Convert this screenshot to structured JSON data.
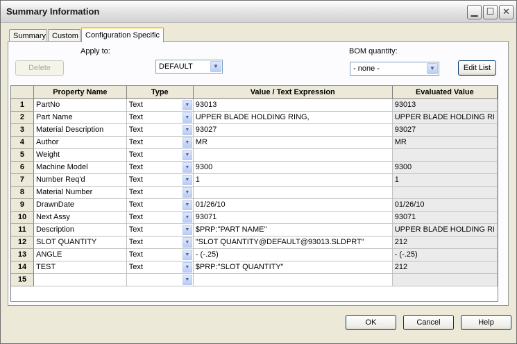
{
  "window": {
    "title": "Summary Information"
  },
  "tabs": [
    "Summary",
    "Custom",
    "Configuration Specific"
  ],
  "apply_to": {
    "label": "Apply to:",
    "value": "DEFAULT"
  },
  "delete_label": "Delete",
  "bom": {
    "label": "BOM quantity:",
    "value": "- none -"
  },
  "edit_list_label": "Edit List",
  "table": {
    "headers": [
      "Property Name",
      "Type",
      "Value / Text Expression",
      "Evaluated Value"
    ],
    "rows": [
      {
        "num": "1",
        "name": "PartNo",
        "type": "Text",
        "value": "93013",
        "eval": "93013"
      },
      {
        "num": "2",
        "name": "Part Name",
        "type": "Text",
        "value": "UPPER BLADE HOLDING RING,",
        "eval": "UPPER BLADE HOLDING RI"
      },
      {
        "num": "3",
        "name": "Material Description",
        "type": "Text",
        "value": "93027",
        "eval": "93027"
      },
      {
        "num": "4",
        "name": "Author",
        "type": "Text",
        "value": "MR",
        "eval": "MR"
      },
      {
        "num": "5",
        "name": "Weight",
        "type": "Text",
        "value": "",
        "eval": ""
      },
      {
        "num": "6",
        "name": "Machine Model",
        "type": "Text",
        "value": "9300",
        "eval": "9300"
      },
      {
        "num": "7",
        "name": "Number Req'd",
        "type": "Text",
        "value": "1",
        "eval": "1"
      },
      {
        "num": "8",
        "name": "Material Number",
        "type": "Text",
        "value": "",
        "eval": ""
      },
      {
        "num": "9",
        "name": "DrawnDate",
        "type": "Text",
        "value": "01/26/10",
        "eval": "01/26/10"
      },
      {
        "num": "10",
        "name": "Next Assy",
        "type": "Text",
        "value": "93071",
        "eval": "93071"
      },
      {
        "num": "11",
        "name": "Description",
        "type": "Text",
        "value": "$PRP:\"PART NAME\"",
        "eval": "UPPER BLADE HOLDING RI"
      },
      {
        "num": "12",
        "name": "SLOT QUANTITY",
        "type": "Text",
        "value": "\"SLOT QUANTITY@DEFAULT@93013.SLDPRT\"",
        "eval": "212"
      },
      {
        "num": "13",
        "name": "ANGLE",
        "type": "Text",
        "value": "- (-.25)",
        "eval": "- (-.25)"
      },
      {
        "num": "14",
        "name": "TEST",
        "type": "Text",
        "value": "$PRP:\"SLOT QUANTITY\"",
        "eval": "212"
      },
      {
        "num": "15",
        "name": "",
        "type": "",
        "value": "",
        "eval": ""
      }
    ]
  },
  "buttons": {
    "ok": "OK",
    "cancel": "Cancel",
    "help": "Help"
  }
}
